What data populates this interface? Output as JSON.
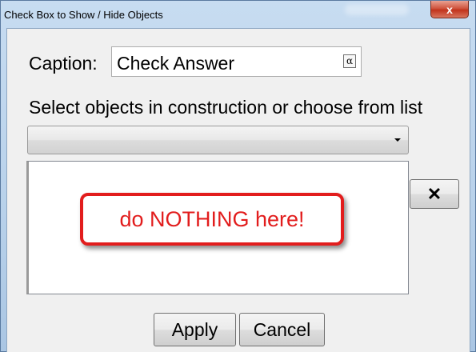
{
  "window": {
    "title": "Check Box to Show / Hide Objects",
    "close_label": "x"
  },
  "caption": {
    "label": "Caption:",
    "value": "Check Answer",
    "symbol_button": "α"
  },
  "objects": {
    "instruction": "Select objects in construction or choose from list",
    "dropdown_selected": "",
    "remove_label": "✕"
  },
  "annotation": {
    "text": "do NOTHING here!",
    "color": "#e21d1d"
  },
  "buttons": {
    "apply": "Apply",
    "cancel": "Cancel"
  }
}
